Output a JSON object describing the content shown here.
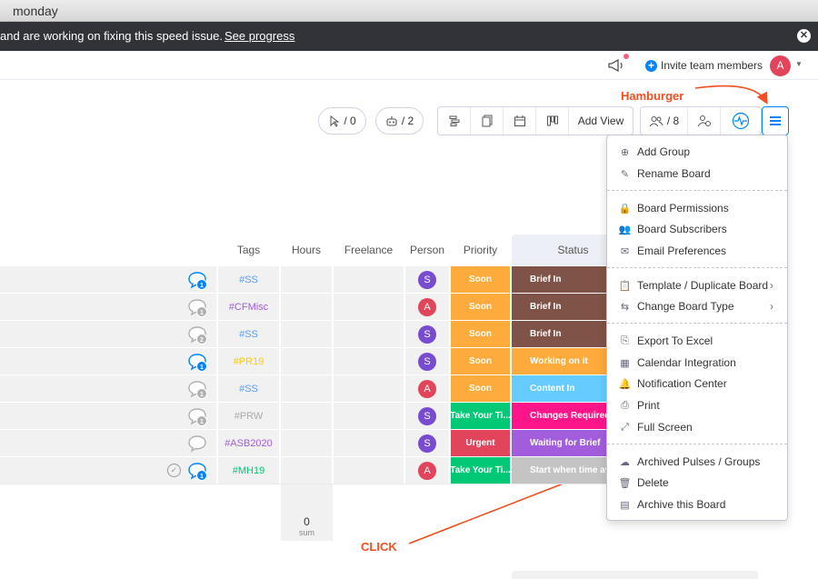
{
  "window": {
    "title": "monday"
  },
  "banner": {
    "message": "and are working on fixing this speed issue.",
    "link": "See progress"
  },
  "topbar": {
    "invite_label": "Invite team members",
    "avatar_letter": "A"
  },
  "toolbar": {
    "activity_count": "/ 0",
    "automations_count": "/ 2",
    "add_view_label": "Add View",
    "members_count": "/ 8"
  },
  "annotations": {
    "hamburger": "Hamburger",
    "click": "CLICK"
  },
  "table": {
    "headers": {
      "tags": "Tags",
      "hours": "Hours",
      "freelance": "Freelance",
      "person": "Person",
      "priority": "Priority",
      "status": "Status"
    },
    "rows": [
      {
        "tag": "#SS",
        "tag_color": "#579bfc",
        "person": "S",
        "person_color": "#784bd1",
        "priority": "Soon",
        "priority_color": "#fdab3d",
        "status": "Brief In",
        "status_color": "#7f5347",
        "chat_active": true,
        "chat_count": "1",
        "check": false
      },
      {
        "tag": "#CFMisc",
        "tag_color": "#a25ddc",
        "person": "A",
        "person_color": "#e2445c",
        "priority": "Soon",
        "priority_color": "#fdab3d",
        "status": "Brief In",
        "status_color": "#7f5347",
        "chat_active": false,
        "chat_count": "1",
        "check": false
      },
      {
        "tag": "#SS",
        "tag_color": "#579bfc",
        "person": "S",
        "person_color": "#784bd1",
        "priority": "Soon",
        "priority_color": "#fdab3d",
        "status": "Brief In",
        "status_color": "#7f5347",
        "chat_active": false,
        "chat_count": "2",
        "check": false
      },
      {
        "tag": "#PR19",
        "tag_color": "#ffcb00",
        "person": "S",
        "person_color": "#784bd1",
        "priority": "Soon",
        "priority_color": "#fdab3d",
        "status": "Working on it",
        "status_color": "#fdab3d",
        "chat_active": true,
        "chat_count": "1",
        "check": false
      },
      {
        "tag": "#SS",
        "tag_color": "#579bfc",
        "person": "A",
        "person_color": "#e2445c",
        "priority": "Soon",
        "priority_color": "#fdab3d",
        "status": "Content In",
        "status_color": "#66ccff",
        "chat_active": false,
        "chat_count": "1",
        "check": false
      },
      {
        "tag": "#PRW",
        "tag_color": "#aaaaaa",
        "person": "S",
        "person_color": "#784bd1",
        "priority": "Take Your Ti...",
        "priority_color": "#00c875",
        "status": "Changes Required",
        "status_color": "#ff158a",
        "chat_active": false,
        "chat_count": "1",
        "check": false
      },
      {
        "tag": "#ASB2020",
        "tag_color": "#a25ddc",
        "person": "S",
        "person_color": "#784bd1",
        "priority": "Urgent",
        "priority_color": "#e2445c",
        "status": "Waiting for Brief",
        "status_color": "#a25ddc",
        "chat_active": false,
        "chat_count": "",
        "check": false
      },
      {
        "tag": "#MH19",
        "tag_color": "#00c875",
        "person": "A",
        "person_color": "#e2445c",
        "priority": "Take Your Ti...",
        "priority_color": "#00c875",
        "status": "Start when time av...",
        "status_color": "#c4c4c4",
        "chat_active": true,
        "chat_count": "1",
        "check": true
      }
    ],
    "sum": {
      "value": "0",
      "label": "sum"
    }
  },
  "menu": {
    "items": [
      {
        "label": "Add Group",
        "icon": "plus-circle-icon",
        "glyph": "⊕",
        "submenu": false
      },
      {
        "label": "Rename Board",
        "icon": "pencil-icon",
        "glyph": "✎",
        "submenu": false
      },
      {
        "label": "Board Permissions",
        "icon": "lock-icon",
        "glyph": "🔒",
        "submenu": false
      },
      {
        "label": "Board Subscribers",
        "icon": "people-icon",
        "glyph": "👥",
        "submenu": false
      },
      {
        "label": "Email Preferences",
        "icon": "envelope-icon",
        "glyph": "✉",
        "submenu": false
      },
      {
        "label": "Template / Duplicate Board",
        "icon": "clipboard-icon",
        "glyph": "📋",
        "submenu": true
      },
      {
        "label": "Change Board Type",
        "icon": "swap-icon",
        "glyph": "⇆",
        "submenu": true
      },
      {
        "label": "Export To Excel",
        "icon": "export-icon",
        "glyph": "⎘",
        "submenu": false
      },
      {
        "label": "Calendar Integration",
        "icon": "calendar-icon",
        "glyph": "▦",
        "submenu": false
      },
      {
        "label": "Notification Center",
        "icon": "bell-icon",
        "glyph": "🔔",
        "submenu": false
      },
      {
        "label": "Print",
        "icon": "printer-icon",
        "glyph": "⎙",
        "submenu": false
      },
      {
        "label": "Full Screen",
        "icon": "expand-icon",
        "glyph": "⤢",
        "submenu": false
      },
      {
        "label": "Archived Pulses / Groups",
        "icon": "cloud-icon",
        "glyph": "☁",
        "submenu": false
      },
      {
        "label": "Delete",
        "icon": "trash-icon",
        "glyph": "🗑",
        "submenu": false
      },
      {
        "label": "Archive this Board",
        "icon": "archive-icon",
        "glyph": "▤",
        "submenu": false
      }
    ],
    "chevron": "›"
  }
}
